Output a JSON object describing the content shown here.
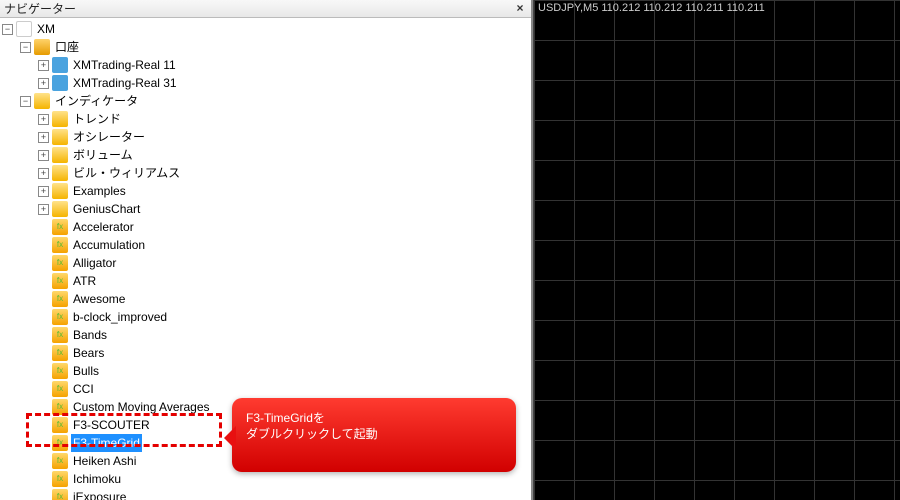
{
  "navigator": {
    "title": "ナビゲーター",
    "root": "XM",
    "account": {
      "label": "口座",
      "servers": [
        "XMTrading-Real 11",
        "XMTrading-Real 31"
      ]
    },
    "indicators": {
      "label": "インディケータ",
      "folders": [
        "トレンド",
        "オシレーター",
        "ボリューム",
        "ビル・ウィリアムス",
        "Examples",
        "GeniusChart"
      ],
      "items": [
        "Accelerator",
        "Accumulation",
        "Alligator",
        "ATR",
        "Awesome",
        "b-clock_improved",
        "Bands",
        "Bears",
        "Bulls",
        "CCI",
        "Custom Moving Averages",
        "F3-SCOUTER",
        "F3-TimeGrid",
        "Heiken Ashi",
        "Ichimoku",
        "iExposure"
      ]
    },
    "selected": "F3-TimeGrid"
  },
  "callout": {
    "line1": "F3-TimeGridを",
    "line2": "ダブルクリックして起動"
  },
  "chart": {
    "title": "USDJPY,M5 110.212 110.212 110.211 110.211"
  }
}
